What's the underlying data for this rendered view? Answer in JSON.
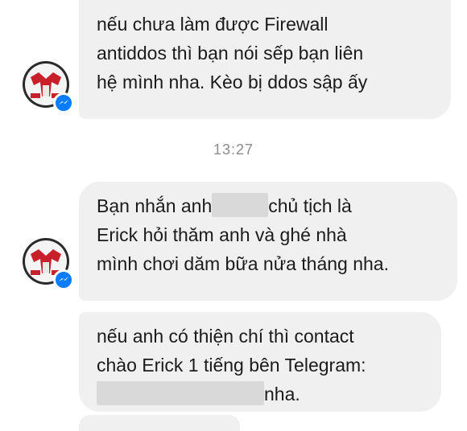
{
  "conversation": {
    "timestamp": "13:27",
    "messages": [
      {
        "lines": [
          "nếu chưa làm được Firewall",
          "antiddos thì bạn nói sếp bạn liên",
          "hệ mình nha. Kèo bị ddos sập ấy"
        ]
      },
      {
        "line1_before": "Bạn nhắn anh",
        "line1_after": "chủ tịch là",
        "line2": "Erick hỏi thăm anh và ghé nhà",
        "line3": "mình chơi dăm bữa nửa tháng nha."
      },
      {
        "line1": "nếu anh có thiện chí thì contact",
        "line2": "chào Erick 1 tiếng bên Telegram:",
        "line3_after": "nha."
      }
    ]
  },
  "sender": {
    "avatar_icon": "red-logo-avatar-icon",
    "badge_icon": "messenger-badge-icon",
    "badge_color": "#0a7cff"
  },
  "colors": {
    "bubble": "#f0f0f0",
    "text": "#1b1b1b",
    "timestamp": "#8c8c8c",
    "redacted": "#d9d9d9"
  }
}
